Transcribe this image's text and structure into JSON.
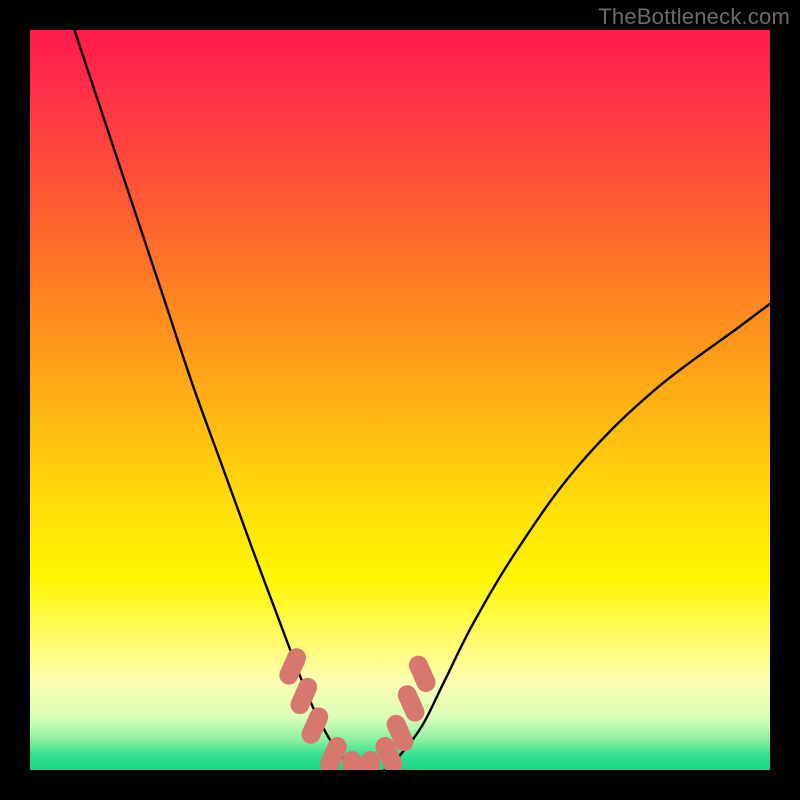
{
  "watermark": "TheBottleneck.com",
  "chart_data": {
    "type": "line",
    "title": "",
    "xlabel": "",
    "ylabel": "",
    "xlim": [
      0,
      100
    ],
    "ylim": [
      0,
      100
    ],
    "grid": false,
    "series": [
      {
        "name": "bottleneck-curve",
        "color": "#000000",
        "x": [
          6,
          10,
          14,
          18,
          22,
          26,
          30,
          33,
          36,
          38,
          40,
          42,
          44,
          46,
          48,
          50,
          53,
          56,
          60,
          66,
          74,
          84,
          96,
          100
        ],
        "y": [
          100,
          88,
          76,
          64,
          52,
          41,
          30,
          22,
          14,
          9,
          5,
          2,
          0,
          0,
          0,
          2,
          6,
          12,
          20,
          30,
          41,
          51,
          60,
          63
        ]
      },
      {
        "name": "valley-markers",
        "type": "scatter",
        "color": "#d6786d",
        "x": [
          35.5,
          37.0,
          38.5,
          41.0,
          43.5,
          46.0,
          48.5,
          50.0,
          51.5,
          53.0
        ],
        "y": [
          14,
          10,
          6,
          2,
          0,
          0,
          2,
          5,
          9,
          13
        ]
      }
    ],
    "gradient_stops": [
      {
        "pos": 0.0,
        "color": "#ff1a4d"
      },
      {
        "pos": 0.45,
        "color": "#ffa018"
      },
      {
        "pos": 0.74,
        "color": "#fff600"
      },
      {
        "pos": 0.93,
        "color": "#d8ffb8"
      },
      {
        "pos": 1.0,
        "color": "#18d888"
      }
    ]
  }
}
